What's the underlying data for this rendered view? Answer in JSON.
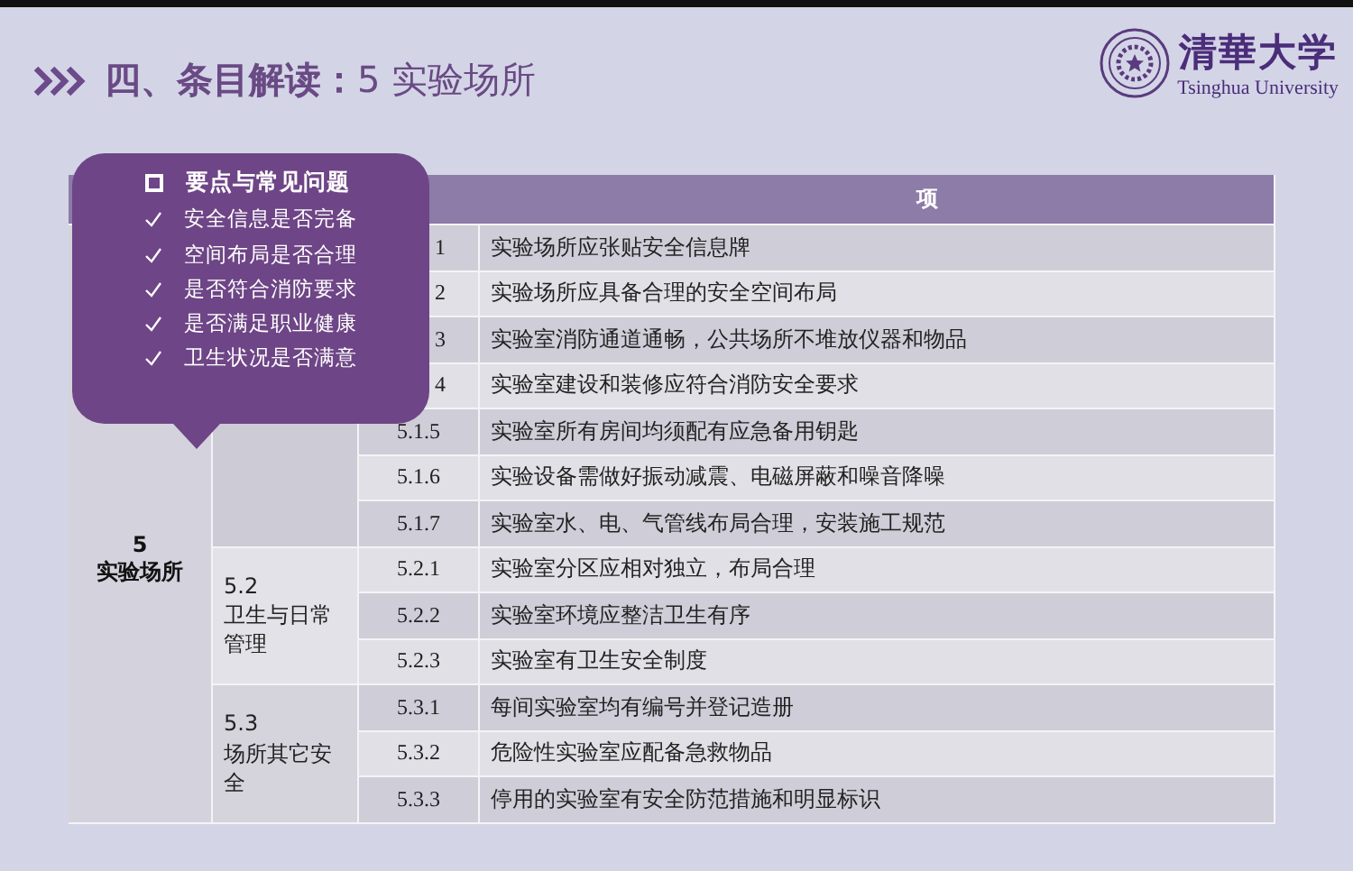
{
  "header": {
    "title_bold": "四、条目解读：",
    "title_rest": "5 实验场所"
  },
  "logo": {
    "name": "清華大学",
    "subtitle": "Tsinghua University"
  },
  "table": {
    "header_label": "项",
    "section": {
      "number": "5",
      "name": "实验场所"
    },
    "groups": [
      {
        "rows": [
          {
            "code": "1",
            "clipped": true,
            "text": "实验场所应张贴安全信息牌"
          },
          {
            "code": "2",
            "clipped": true,
            "text": "实验场所应具备合理的安全空间布局"
          },
          {
            "code": "3",
            "clipped": true,
            "text": "实验室消防通道通畅，公共场所不堆放仪器和物品"
          },
          {
            "code": "4",
            "clipped": true,
            "text": "实验室建设和装修应符合消防安全要求"
          },
          {
            "code": "5.1.5",
            "clipped": false,
            "text": "实验室所有房间均须配有应急备用钥匙"
          },
          {
            "code": "5.1.6",
            "clipped": false,
            "text": "实验设备需做好振动减震、电磁屏蔽和噪音降噪"
          },
          {
            "code": "5.1.7",
            "clipped": false,
            "text": "实验室水、电、气管线布局合理，安装施工规范"
          }
        ]
      },
      {
        "number": "5.2",
        "name": "卫生与日常管理",
        "rows": [
          {
            "code": "5.2.1",
            "clipped": false,
            "text": "实验室分区应相对独立，布局合理"
          },
          {
            "code": "5.2.2",
            "clipped": false,
            "text": "实验室环境应整洁卫生有序"
          },
          {
            "code": "5.2.3",
            "clipped": false,
            "text": "实验室有卫生安全制度"
          }
        ]
      },
      {
        "number": "5.3",
        "name": "场所其它安全",
        "rows": [
          {
            "code": "5.3.1",
            "clipped": false,
            "text": "每间实验室均有编号并登记造册"
          },
          {
            "code": "5.3.2",
            "clipped": false,
            "text": "危险性实验室应配备急救物品"
          },
          {
            "code": "5.3.3",
            "clipped": false,
            "text": "停用的实验室有安全防范措施和明显标识"
          }
        ]
      }
    ]
  },
  "popup": {
    "title": "要点与常见问题",
    "items": [
      "安全信息是否完备",
      "空间布局是否合理",
      "是否符合消防要求",
      "是否满足职业健康",
      "卫生状况是否满意"
    ]
  }
}
